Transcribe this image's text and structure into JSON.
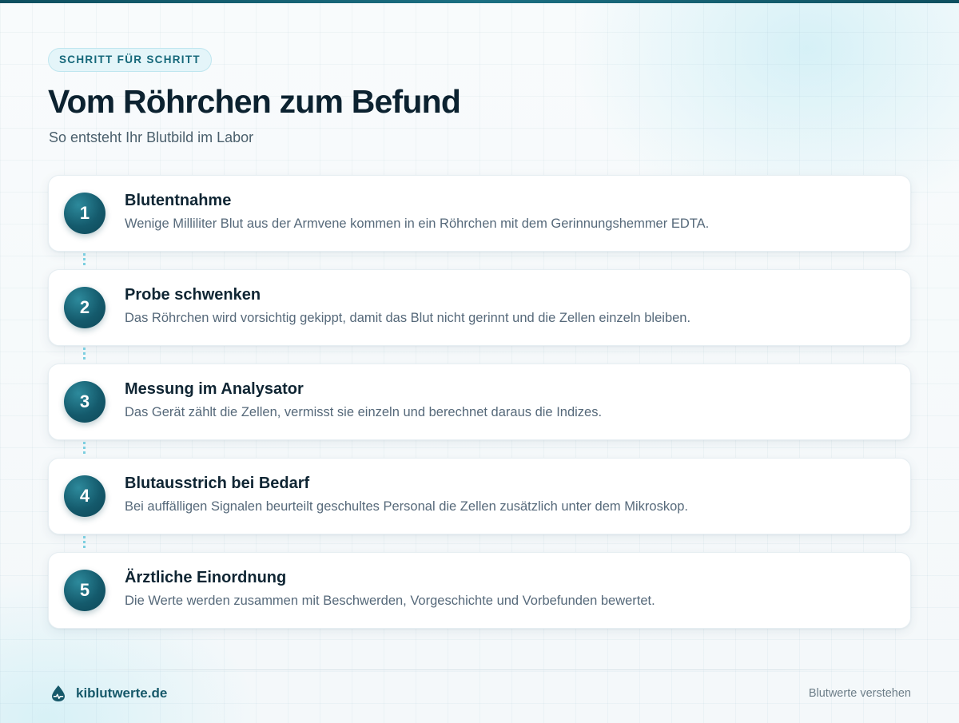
{
  "header": {
    "eyebrow": "SCHRITT FÜR SCHRITT",
    "title": "Vom Röhrchen zum Befund",
    "subtitle": "So entsteht Ihr Blutbild im Labor"
  },
  "steps": [
    {
      "number": "1",
      "title": "Blutentnahme",
      "description": "Wenige Milliliter Blut aus der Armvene kommen in ein Röhrchen mit dem Gerinnungshemmer EDTA."
    },
    {
      "number": "2",
      "title": "Probe schwenken",
      "description": "Das Röhrchen wird vorsichtig gekippt, damit das Blut nicht gerinnt und die Zellen einzeln bleiben."
    },
    {
      "number": "3",
      "title": "Messung im Analysator",
      "description": "Das Gerät zählt die Zellen, vermisst sie einzeln und berechnet daraus die Indizes."
    },
    {
      "number": "4",
      "title": "Blutausstrich bei Bedarf",
      "description": "Bei auffälligen Signalen beurteilt geschultes Personal die Zellen zusätzlich unter dem Mikroskop."
    },
    {
      "number": "5",
      "title": "Ärztliche Einordnung",
      "description": "Die Werte werden zusammen mit Beschwerden, Vorgeschichte und Vorbefunden bewertet."
    }
  ],
  "footer": {
    "brand": "kiblutwerte.de",
    "brand_icon": "blood-drop-icon",
    "tagline": "Blutwerte verstehen"
  },
  "colors": {
    "accent": "#17596a",
    "badge_gradient_dark": "#0e4757",
    "connector": "#7ccfe0"
  }
}
